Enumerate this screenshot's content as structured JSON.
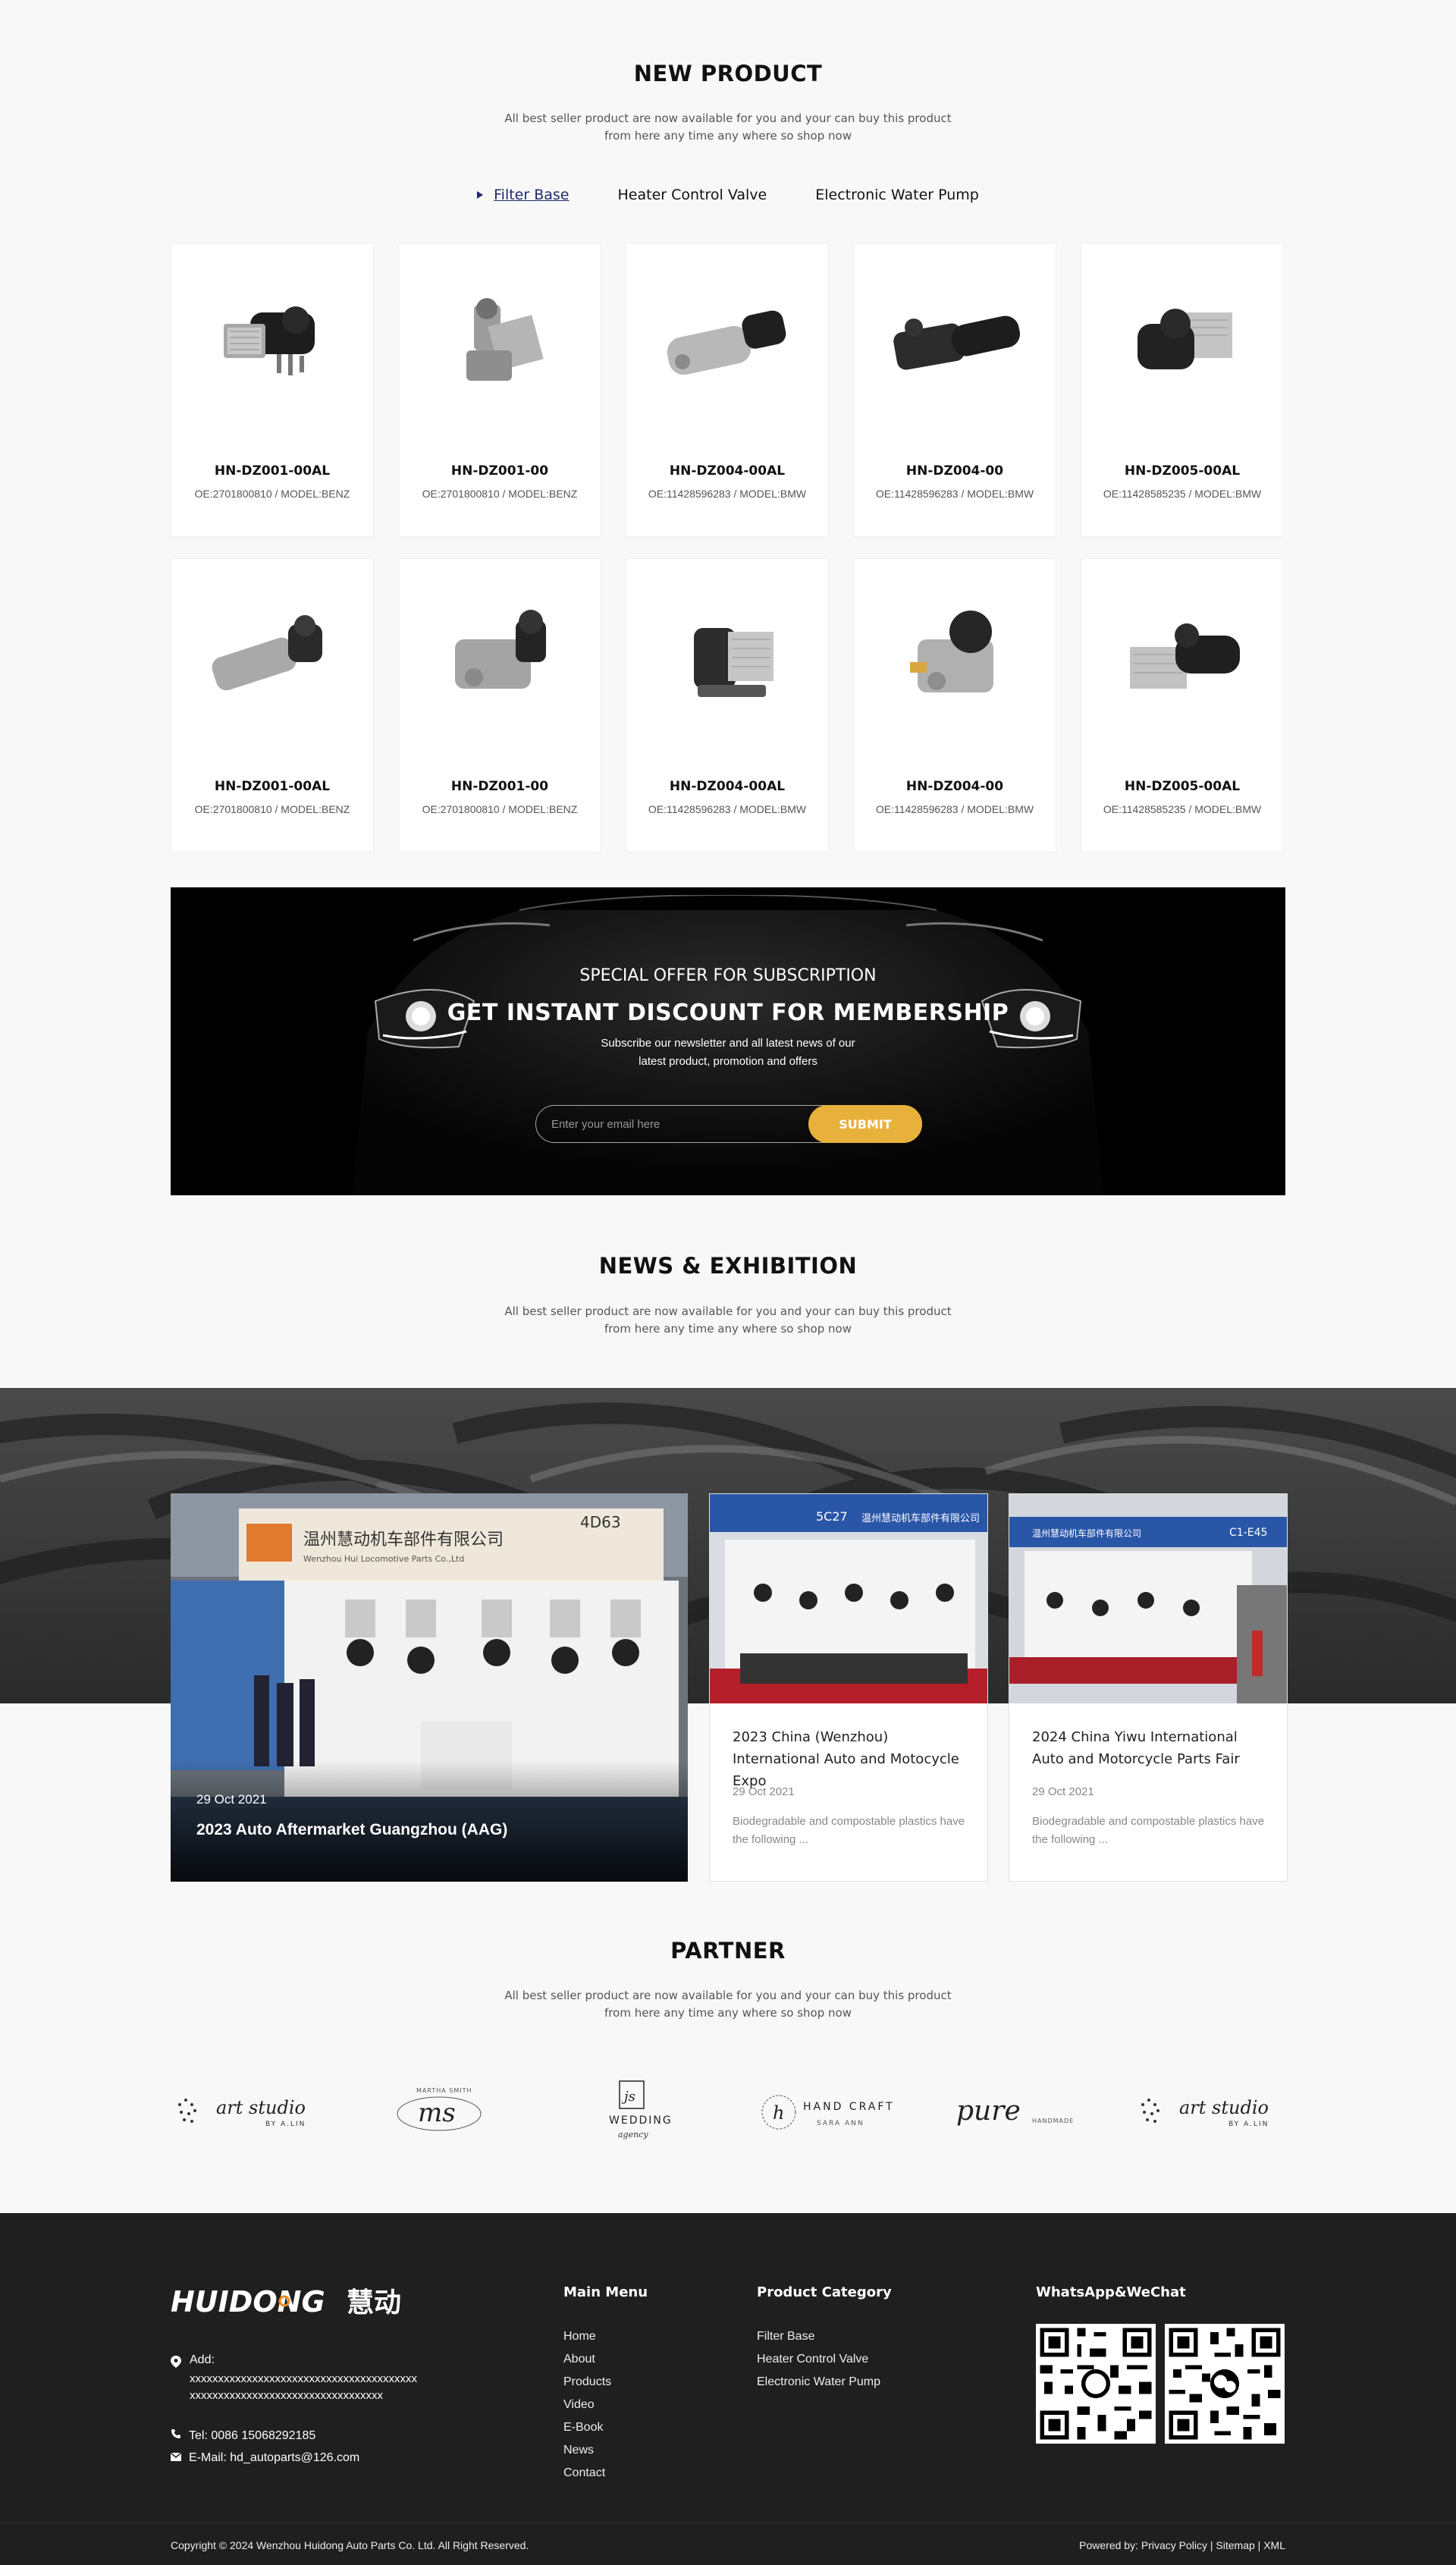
{
  "new_product": {
    "title": "NEW PRODUCT",
    "subtitle_line1": "All best seller product are now available for you and your can buy this product",
    "subtitle_line2": "from here any time any where so shop now",
    "tabs": [
      {
        "label": "Filter Base",
        "active": true
      },
      {
        "label": "Heater Control Valve",
        "active": false
      },
      {
        "label": "Electronic Water Pump",
        "active": false
      }
    ],
    "products": [
      {
        "name": "HN-DZ001-00AL",
        "spec": "OE:2701800810 / MODEL:BENZ"
      },
      {
        "name": "HN-DZ001-00",
        "spec": "OE:2701800810 / MODEL:BENZ"
      },
      {
        "name": "HN-DZ004-00AL",
        "spec": "OE:11428596283 / MODEL:BMW"
      },
      {
        "name": "HN-DZ004-00",
        "spec": "OE:11428596283 / MODEL:BMW"
      },
      {
        "name": "HN-DZ005-00AL",
        "spec": "OE:11428585235 / MODEL:BMW"
      },
      {
        "name": "HN-DZ001-00AL",
        "spec": "OE:2701800810 / MODEL:BENZ"
      },
      {
        "name": "HN-DZ001-00",
        "spec": "OE:2701800810 / MODEL:BENZ"
      },
      {
        "name": "HN-DZ004-00AL",
        "spec": "OE:11428596283 / MODEL:BMW"
      },
      {
        "name": "HN-DZ004-00",
        "spec": "OE:11428596283 / MODEL:BMW"
      },
      {
        "name": "HN-DZ005-00AL",
        "spec": "OE:11428585235 / MODEL:BMW"
      }
    ]
  },
  "subscribe": {
    "kicker": "SPECIAL OFFER FOR SUBSCRIPTION",
    "title": "GET INSTANT DISCOUNT FOR MEMBERSHIP",
    "text_line1": "Subscribe our newsletter and all latest news of our",
    "text_line2": "latest product, promotion and offers",
    "placeholder": "Enter your email here",
    "button": "SUBMIT"
  },
  "news": {
    "title": "NEWS & EXHIBITION",
    "subtitle_line1": "All best seller product are now available for you and your can buy this product",
    "subtitle_line2": "from here any time any where so shop now",
    "featured": {
      "date": "29 Oct 2021",
      "title": "2023 Auto Aftermarket Guangzhou (AAG)",
      "booth_sign": "温州慧动机车部件有限公司",
      "booth_sign_en": "Wenzhou Hui Locomotive Parts Co.,Ltd",
      "booth_no": "4D63"
    },
    "items": [
      {
        "title": "2023 China (Wenzhou) International Auto and Motocycle Expo",
        "date": "29 Oct 2021",
        "desc": "Biodegradable and compostable plastics have the following ...",
        "booth_no": "5C27",
        "booth_sign": "温州慧动机车部件有限公司"
      },
      {
        "title": "2024 China Yiwu International Auto and Motorcycle Parts Fair",
        "date": "29 Oct 2021",
        "desc": "Biodegradable and compostable plastics have the following ...",
        "booth_no": "C1-E45",
        "booth_sign": "温州慧动机车部件有限公司"
      }
    ]
  },
  "partner": {
    "title": "PARTNER",
    "subtitle_line1": "All best seller product are now available for you and your can buy this product",
    "subtitle_line2": "from here any time any where so shop now",
    "logos": [
      {
        "name": "art studio by a.lin",
        "main": "art studio",
        "sub": "BY A.LIN"
      },
      {
        "name": "ms",
        "main": "ms",
        "sub": "MARTHA SMITH"
      },
      {
        "name": "js wedding agency",
        "main": "WEDDING",
        "sub": "agency"
      },
      {
        "name": "hand crafted",
        "main": "HAND CRAFTED",
        "sub": "SARA ANN"
      },
      {
        "name": "pure handmade",
        "main": "pure",
        "sub": "HANDMADE"
      },
      {
        "name": "art studio by a.lin",
        "main": "art studio",
        "sub": "BY A.LIN"
      }
    ]
  },
  "footer": {
    "logo_text": "HUIDONG",
    "logo_cn": "慧动",
    "add_label": "Add:",
    "add_line1": "xxxxxxxxxxxxxxxxxxxxxxxxxxxxxxxxxxxxxxxx",
    "add_line2": "xxxxxxxxxxxxxxxxxxxxxxxxxxxxxxxxxx",
    "tel": "Tel: 0086 15068292185",
    "email": "E-Mail: hd_autoparts@126.com",
    "main_menu_title": "Main Menu",
    "main_menu": [
      "Home",
      "About",
      "Products",
      "Video",
      "E-Book",
      "News",
      "Contact"
    ],
    "category_title": "Product Category",
    "categories": [
      "Filter Base",
      "Heater Control Valve",
      "Electronic Water Pump"
    ],
    "qr_title": "WhatsApp&WeChat",
    "copyright": "Copyright © 2024 Wenzhou Huidong Auto Parts Co. Ltd. All Right Reserved.",
    "powered_prefix": "Powered by:",
    "privacy": "Privacy Policy",
    "sitemap": "Sitemap",
    "xml": "XML",
    "sep": "|"
  },
  "colors": {
    "accent_yellow": "#e8b13b",
    "tab_active": "#1f2a6e",
    "footer_bg": "#1f1f1f",
    "logo_orange": "#f08a24"
  }
}
